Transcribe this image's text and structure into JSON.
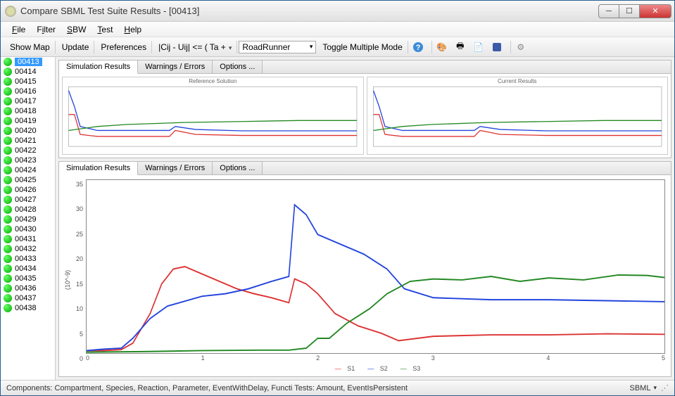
{
  "window": {
    "title": "Compare SBML Test Suite Results   -   [00413]"
  },
  "menu": [
    "File",
    "Filter",
    "SBW",
    "Test",
    "Help"
  ],
  "toolbar": {
    "show_map": "Show Map",
    "update": "Update",
    "prefs": "Preferences",
    "formula": "|Cij - Uij| <= ( Ta +",
    "engine": "RoadRunner",
    "toggle": "Toggle Multiple Mode"
  },
  "sidebar": {
    "selected": "00413",
    "items": [
      "00413",
      "00414",
      "00415",
      "00416",
      "00417",
      "00418",
      "00419",
      "00420",
      "00421",
      "00422",
      "00423",
      "00424",
      "00425",
      "00426",
      "00427",
      "00428",
      "00429",
      "00430",
      "00431",
      "00432",
      "00433",
      "00434",
      "00435",
      "00436",
      "00437",
      "00438"
    ]
  },
  "tabs": {
    "sim": "Simulation Results",
    "warn": "Warnings / Errors",
    "opt": "Options ..."
  },
  "mini": {
    "left_title": "Reference Solution",
    "right_title": "Current Results"
  },
  "chart_data": {
    "type": "line",
    "title": "",
    "xlabel": "",
    "ylabel": "(10^-9)",
    "xlim": [
      0,
      5
    ],
    "ylim": [
      0,
      35
    ],
    "xticks": [
      0,
      1,
      2,
      3,
      4,
      5
    ],
    "yticks": [
      0,
      5,
      10,
      15,
      20,
      25,
      30,
      35
    ],
    "series": [
      {
        "name": "S1",
        "color": "#dd3333",
        "x": [
          0,
          0.15,
          0.3,
          0.4,
          0.55,
          0.65,
          0.75,
          0.85,
          1.0,
          1.15,
          1.3,
          1.45,
          1.6,
          1.75,
          1.8,
          1.9,
          2.0,
          2.15,
          2.35,
          2.55,
          2.7,
          3.0,
          3.5,
          4.0,
          4.5,
          5.0
        ],
        "y": [
          0.5,
          0.5,
          0.7,
          2,
          8,
          14,
          17,
          17.5,
          16,
          14.5,
          13,
          12,
          11.2,
          10.2,
          15,
          14,
          12,
          8,
          5.5,
          4,
          2.5,
          3.4,
          3.7,
          3.7,
          3.9,
          3.8
        ]
      },
      {
        "name": "S2",
        "color": "#2244dd",
        "x": [
          0,
          0.15,
          0.3,
          0.4,
          0.55,
          0.7,
          0.85,
          1.0,
          1.2,
          1.4,
          1.6,
          1.75,
          1.8,
          1.9,
          2.0,
          2.2,
          2.4,
          2.6,
          2.75,
          3.0,
          3.5,
          4.0,
          4.5,
          5.0
        ],
        "y": [
          0.5,
          0.8,
          1.0,
          3,
          7,
          9.5,
          10.5,
          11.5,
          12.0,
          13.0,
          14.5,
          15.5,
          30,
          28,
          24,
          22,
          20,
          17,
          13,
          11.2,
          10.8,
          10.8,
          10.6,
          10.4
        ]
      },
      {
        "name": "S3",
        "color": "#228822",
        "x": [
          0,
          0.5,
          1.0,
          1.5,
          1.75,
          1.9,
          2.0,
          2.1,
          2.25,
          2.45,
          2.6,
          2.8,
          3.0,
          3.25,
          3.5,
          3.75,
          4.0,
          4.3,
          4.6,
          4.85,
          5.0
        ],
        "y": [
          0.2,
          0.3,
          0.5,
          0.6,
          0.6,
          1.0,
          3,
          3,
          6,
          9,
          12,
          14.5,
          15,
          14.8,
          15.5,
          14.5,
          15.2,
          14.8,
          15.8,
          15.7,
          15.3
        ]
      }
    ],
    "legend": [
      "S1",
      "S2",
      "S3"
    ]
  },
  "mini_chart": {
    "series": [
      {
        "color": "#dd3333",
        "x": [
          0,
          0.1,
          0.2,
          0.5,
          1.0,
          1.75,
          1.85,
          2.2,
          3.0,
          5.0
        ],
        "y": [
          1.6,
          1.6,
          0.6,
          0.5,
          0.5,
          0.5,
          0.8,
          0.6,
          0.55,
          0.55
        ]
      },
      {
        "color": "#2244dd",
        "x": [
          0,
          0.1,
          0.2,
          0.5,
          1.0,
          1.75,
          1.85,
          2.2,
          3.0,
          5.0
        ],
        "y": [
          2.8,
          2.0,
          1.0,
          0.8,
          0.8,
          0.8,
          1.0,
          0.85,
          0.78,
          0.78
        ]
      },
      {
        "color": "#228822",
        "x": [
          0,
          0.5,
          1.0,
          2.0,
          3.0,
          4.0,
          5.0
        ],
        "y": [
          0.8,
          1.0,
          1.1,
          1.2,
          1.25,
          1.3,
          1.3
        ]
      }
    ],
    "xlim": [
      0,
      5
    ],
    "ylim": [
      0,
      3
    ]
  },
  "status": {
    "left": "Components: Compartment, Species, Reaction, Parameter, EventWithDelay, Functi Tests: Amount, EventIsPersistent",
    "right": "SBML"
  }
}
